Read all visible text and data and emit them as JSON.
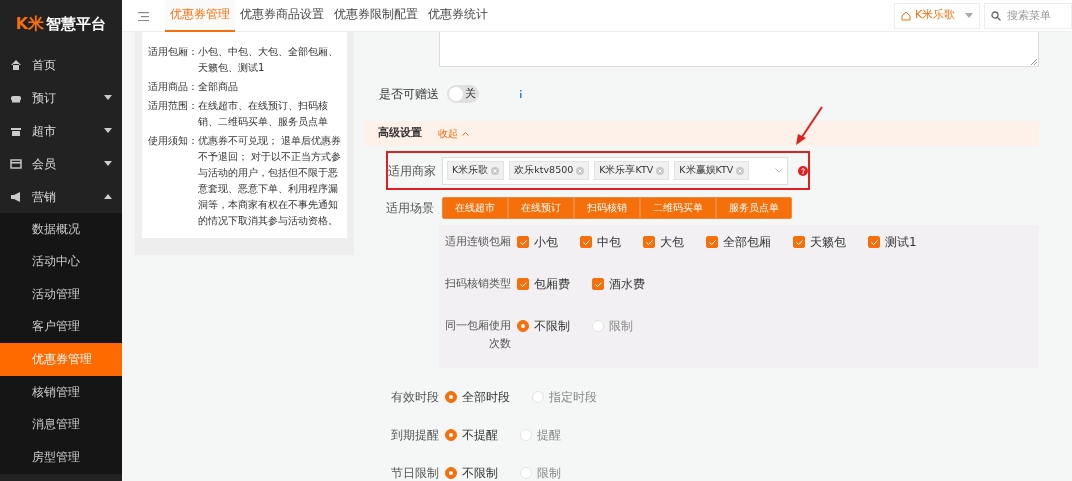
{
  "logo": {
    "mark": "K米",
    "text": "智慧平台"
  },
  "sidebar": {
    "items": [
      {
        "label": "首页"
      },
      {
        "label": "预订",
        "expanded": false
      },
      {
        "label": "超市",
        "expanded": false
      },
      {
        "label": "会员",
        "expanded": false
      },
      {
        "label": "营销",
        "expanded": true,
        "children": [
          {
            "label": "数据概况",
            "selected": false
          },
          {
            "label": "活动中心",
            "selected": false
          },
          {
            "label": "活动管理",
            "selected": false
          },
          {
            "label": "客户管理",
            "selected": false
          },
          {
            "label": "优惠券管理",
            "selected": true
          },
          {
            "label": "核销管理",
            "selected": false
          },
          {
            "label": "消息管理",
            "selected": false
          },
          {
            "label": "房型管理",
            "selected": false
          }
        ]
      }
    ]
  },
  "tabs": [
    {
      "label": "优惠券管理",
      "selected": true
    },
    {
      "label": "优惠券商品设置",
      "selected": false
    },
    {
      "label": "优惠券限制配置",
      "selected": false
    },
    {
      "label": "优惠券统计",
      "selected": false
    }
  ],
  "store_selector": {
    "label": "K米乐歌"
  },
  "menu_search": {
    "placeholder": "搜索菜单"
  },
  "summary": [
    {
      "label": "适用包厢：",
      "value": "小包、中包、大包、全部包厢、天籁包、测试1"
    },
    {
      "label": "适用商品：",
      "value": "全部商品"
    },
    {
      "label": "适用范围：",
      "value": "在线超市、在线预订、扫码核销、二维码买单、服务员点单"
    },
    {
      "label": "使用须知：",
      "value": "优惠券不可兑现； 退单后优惠券不予退回； 对于以不正当方式参与活动的用户，包括但不限于恶意套现、恶意下单、利用程序漏洞等，本商家有权在不事先通知的情况下取消其参与活动资格。"
    }
  ],
  "gift": {
    "label": "是否可赠送",
    "text": "关",
    "on": false
  },
  "advanced": {
    "title": "高级设置",
    "link": "收起"
  },
  "merchants": {
    "label": "适用商家",
    "highlighted": true,
    "tags": [
      "K米乐歌",
      "欢乐ktv8500",
      "K米乐享KTV",
      "K米赢娱KTV"
    ]
  },
  "scenes": {
    "label": "适用场景",
    "options": [
      {
        "label": "在线超市",
        "selected": true
      },
      {
        "label": "在线预订",
        "selected": true
      },
      {
        "label": "扫码核销",
        "selected": true
      },
      {
        "label": "二维码买单",
        "selected": true
      },
      {
        "label": "服务员点单",
        "selected": true
      }
    ]
  },
  "scene_rules": [
    {
      "kind": "checkbox",
      "label": "适用连锁包厢",
      "options": [
        {
          "label": "小包",
          "checked": true
        },
        {
          "label": "中包",
          "checked": true
        },
        {
          "label": "大包",
          "checked": true
        },
        {
          "label": "全部包厢",
          "checked": true
        },
        {
          "label": "天籁包",
          "checked": true
        },
        {
          "label": "测试1",
          "checked": true
        }
      ]
    },
    {
      "kind": "checkbox",
      "label": "扫码核销类型",
      "options": [
        {
          "label": "包厢费",
          "checked": true
        },
        {
          "label": "酒水费",
          "checked": true
        }
      ]
    },
    {
      "kind": "radio",
      "label": "同一包厢使用次数",
      "options": [
        {
          "label": "不限制",
          "selected": true
        },
        {
          "label": "限制",
          "selected": false
        }
      ]
    }
  ],
  "settings": [
    {
      "kind": "radio",
      "label": "有效时段",
      "options": [
        {
          "label": "全部时段",
          "selected": true
        },
        {
          "label": "指定时段",
          "selected": false
        }
      ]
    },
    {
      "kind": "radio",
      "label": "到期提醒",
      "options": [
        {
          "label": "不提醒",
          "selected": true
        },
        {
          "label": "提醒",
          "selected": false
        }
      ]
    },
    {
      "kind": "radio",
      "label": "节日限制",
      "options": [
        {
          "label": "不限制",
          "selected": true
        },
        {
          "label": "限制",
          "selected": false
        }
      ]
    }
  ]
}
